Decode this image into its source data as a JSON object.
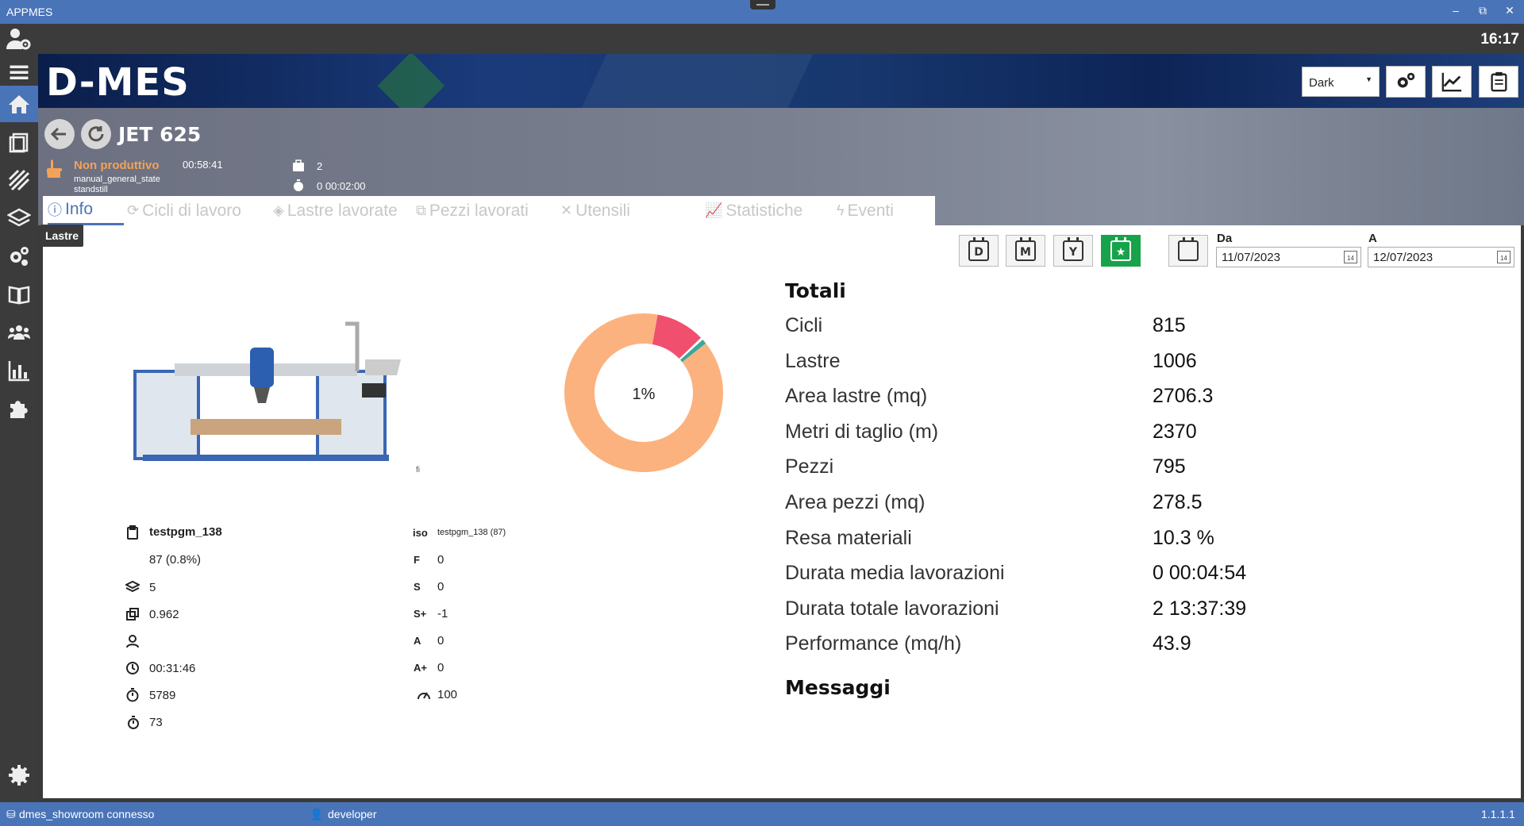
{
  "window": {
    "title": "APPMES",
    "minimize": "‒",
    "restore": "⧉",
    "close": "✕"
  },
  "topbar": {
    "clock": "16:17"
  },
  "banner": {
    "logo": "D-MES"
  },
  "toolbar": {
    "theme": "Dark",
    "icons": [
      "settings-icon",
      "chart-icon",
      "clipboard-icon"
    ]
  },
  "sidebar": {
    "items": [
      "users-gear-icon",
      "menu-icon",
      "home-icon",
      "clipboard-icon",
      "stripes-icon",
      "layers-icon",
      "gears-icon",
      "book-icon",
      "team-icon",
      "bar-chart-icon",
      "puzzle-icon",
      "settings-icon"
    ],
    "active": "home-icon",
    "tooltip": "Lastre"
  },
  "machine": {
    "name": "JET 625",
    "state": "Non produttivo",
    "state_time": "00:58:41",
    "state_code": "manual_general_state",
    "state_sub": "standstill",
    "pieces_count": "2",
    "timer": "0 00:02:00"
  },
  "tabs": [
    {
      "label": "Info",
      "icon": "ⓘ"
    },
    {
      "label": "Cicli di lavoro",
      "icon": "⟳"
    },
    {
      "label": "Lastre lavorate",
      "icon": "◈"
    },
    {
      "label": "Pezzi lavorati",
      "icon": "⧉"
    },
    {
      "label": "Utensili",
      "icon": "✕"
    },
    {
      "label": "Statistiche",
      "icon": "📈"
    },
    {
      "label": "Eventi",
      "icon": "ϟ"
    }
  ],
  "active_tab": "Info",
  "date_filter": {
    "buttons": [
      "D",
      "M",
      "Y",
      "★"
    ],
    "from_label": "Da",
    "from_value": "11/07/2023",
    "to_label": "A",
    "to_value": "12/07/2023",
    "calendar_day": "14"
  },
  "donut": {
    "center_text": "1%",
    "slices": [
      {
        "value": 88.5,
        "color": "#fcb27e"
      },
      {
        "value": 10,
        "color": "#f0506e"
      },
      {
        "value": 0.5,
        "color": "#ffffff"
      },
      {
        "value": 1,
        "color": "#3aa89a"
      }
    ]
  },
  "image_caption": "fi",
  "info": {
    "program": "testpgm_138",
    "program_progress": "87 (0.8%)",
    "slabs": "5",
    "area": "0.962",
    "operator": "",
    "duration": "00:31:46",
    "stopwatch": "5789",
    "stopwatch_s": "73",
    "iso_key": "iso",
    "iso_value": "testpgm_138 (87)",
    "f_key": "F",
    "f_value": "0",
    "s_key": "S",
    "s_value": "0",
    "splus_key": "S+",
    "splus_value": "-1",
    "a_key": "A",
    "a_value": "0",
    "aplus_key": "A+",
    "aplus_value": "0",
    "speed_value": "100"
  },
  "totals": {
    "title": "Totali",
    "rows": [
      {
        "label": "Cicli",
        "value": "815"
      },
      {
        "label": "Lastre",
        "value": "1006"
      },
      {
        "label": "Area lastre (mq)",
        "value": "2706.3"
      },
      {
        "label": "Metri di taglio (m)",
        "value": "2370"
      },
      {
        "label": "Pezzi",
        "value": "795"
      },
      {
        "label": "Area pezzi (mq)",
        "value": "278.5"
      },
      {
        "label": "Resa materiali",
        "value": "10.3 %"
      },
      {
        "label": "Durata media lavorazioni",
        "value": "0 00:04:54"
      },
      {
        "label": "Durata totale lavorazioni",
        "value": "2 13:37:39"
      },
      {
        "label": "Performance (mq/h)",
        "value": "43.9"
      }
    ],
    "messages_title": "Messaggi"
  },
  "status": {
    "connection": "dmes_showroom connesso",
    "user": "developer",
    "version": "1.1.1.1"
  }
}
